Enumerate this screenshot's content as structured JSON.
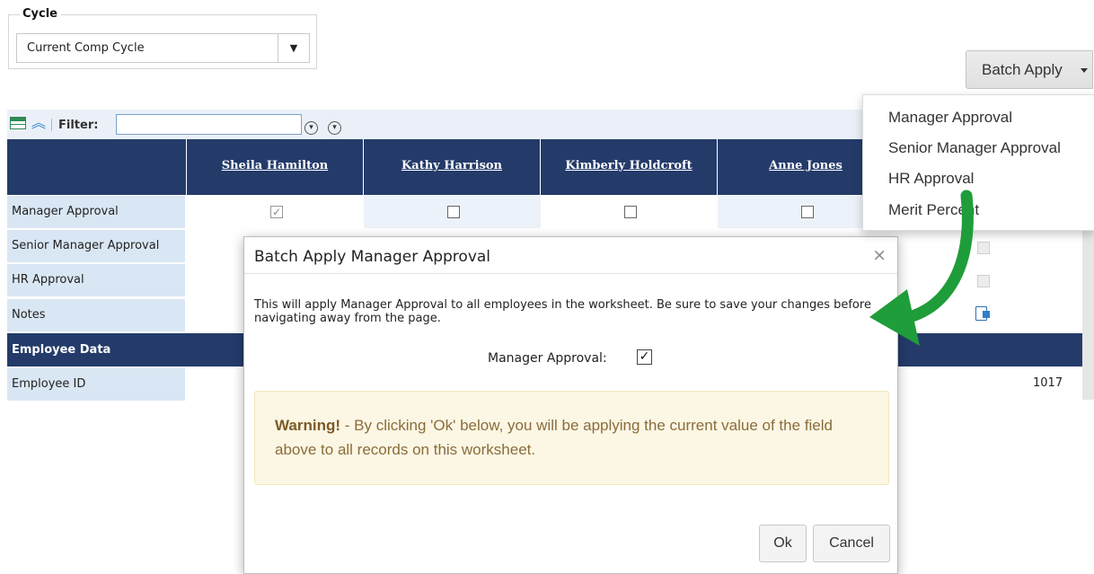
{
  "cycle": {
    "legend": "Cycle",
    "selected": "Current Comp Cycle",
    "arrow": "▼"
  },
  "batch_apply": {
    "label": "Batch Apply",
    "menu": [
      "Manager Approval",
      "Senior Manager Approval",
      "HR Approval",
      "Merit Percent"
    ]
  },
  "toolbar": {
    "filter_label": "Filter:",
    "filter_value": "",
    "icons": [
      "grid-settings-icon",
      "collapse-up-icon",
      "filter-down-icon",
      "filter-clear-icon"
    ]
  },
  "grid": {
    "employees": [
      "Sheila Hamilton",
      "Kathy Harrison",
      "Kimberly Holdcroft",
      "Anne Jones"
    ],
    "rows": [
      "Manager Approval",
      "Senior Manager Approval",
      "HR Approval",
      "Notes"
    ],
    "section": "Employee Data",
    "employee_id_label": "Employee ID",
    "employee_id_value": "1017",
    "manager_approval_checked": [
      true,
      false,
      false,
      false
    ]
  },
  "modal": {
    "title": "Batch Apply Manager Approval",
    "close": "×",
    "message": "This will apply Manager Approval to all employees in the worksheet. Be sure to save your changes before navigating away from the page.",
    "field_label": "Manager Approval:",
    "field_checked": true,
    "check_glyph": "✓",
    "warning_strong": "Warning!",
    "warning_text": " - By clicking 'Ok' below, you will be applying the current value of the field above to all records on this worksheet.",
    "ok": "Ok",
    "cancel": "Cancel"
  },
  "colors": {
    "header_navy": "#243b6a",
    "row_label_bg": "#d9e6f4",
    "arrow_green": "#1f9d3a",
    "warning_bg": "#fcf6e4"
  }
}
